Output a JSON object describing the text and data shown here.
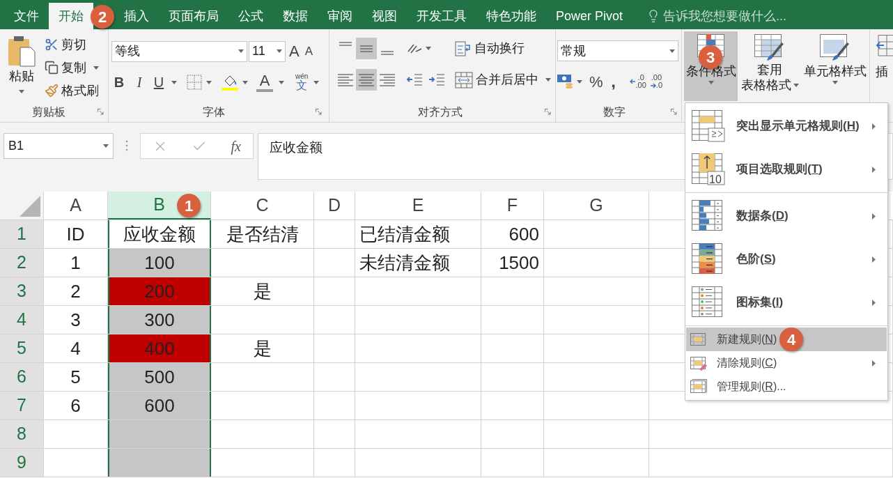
{
  "tabs": [
    {
      "label": "文件",
      "selected": false
    },
    {
      "label": "开始",
      "selected": true,
      "badge": "2"
    },
    {
      "label": "插入",
      "selected": false
    },
    {
      "label": "页面布局",
      "selected": false
    },
    {
      "label": "公式",
      "selected": false
    },
    {
      "label": "数据",
      "selected": false
    },
    {
      "label": "审阅",
      "selected": false
    },
    {
      "label": "视图",
      "selected": false
    },
    {
      "label": "开发工具",
      "selected": false
    },
    {
      "label": "特色功能",
      "selected": false
    },
    {
      "label": "Power Pivot",
      "selected": false
    }
  ],
  "tell_me": "告诉我您想要做什么...",
  "ribbon": {
    "clipboard": {
      "paste": "粘贴",
      "cut": "剪切",
      "copy": "复制",
      "format_painter": "格式刷",
      "title": "剪贴板"
    },
    "font": {
      "family": "等线",
      "size": "11",
      "grow": "A",
      "shrink": "A",
      "bold": "B",
      "italic": "I",
      "underline": "U",
      "font_color": "A",
      "phonetic_top": "wén",
      "phonetic": "文",
      "title": "字体"
    },
    "alignment": {
      "buttons": [
        {
          "kind": "top",
          "selected": false
        },
        {
          "kind": "middle",
          "selected": true
        },
        {
          "kind": "bottom",
          "selected": false
        },
        {
          "kind": "left",
          "selected": false
        },
        {
          "kind": "center",
          "selected": true
        },
        {
          "kind": "right",
          "selected": false
        }
      ],
      "wrap": "自动换行",
      "merge": "合并后居中",
      "title": "对齐方式"
    },
    "number": {
      "format": "常规",
      "percent": "%",
      "comma": ",",
      "increase_decimal": [
        ".0",
        ".00"
      ],
      "decrease_decimal": [
        ".00",
        ".0"
      ],
      "title": "数字"
    },
    "styles": {
      "conditional": {
        "label": "条件格式",
        "pressed": true,
        "badge": "3"
      },
      "table": [
        "套用",
        "表格格式"
      ],
      "cell_styles": "单元格样式"
    },
    "cells": {
      "insert": "插"
    }
  },
  "formula_bar": {
    "name_box": "B1",
    "fx": "fx",
    "value": "应收金额"
  },
  "sheet": {
    "columns": [
      {
        "label": "A",
        "selected": false
      },
      {
        "label": "B",
        "selected": true,
        "badge": "1"
      },
      {
        "label": "C",
        "selected": false
      },
      {
        "label": "D",
        "selected": false
      },
      {
        "label": "E",
        "selected": false
      },
      {
        "label": "F",
        "selected": false
      },
      {
        "label": "G",
        "selected": false
      }
    ],
    "rows": [
      {
        "number": "1",
        "cells": [
          {
            "text": "ID"
          },
          {
            "text": "应收金额",
            "active": true
          },
          {
            "text": "是否结清"
          },
          {},
          {
            "text": "已结清金额"
          },
          {
            "text": "600"
          },
          {}
        ]
      },
      {
        "number": "2",
        "cells": [
          {
            "text": "1"
          },
          {
            "text": "100"
          },
          {},
          {},
          {
            "text": "未结清金额"
          },
          {
            "text": "1500"
          },
          {}
        ]
      },
      {
        "number": "3",
        "cells": [
          {
            "text": "2"
          },
          {
            "text": "200",
            "color": "#c00000"
          },
          {
            "text": "是"
          },
          {},
          {},
          {},
          {}
        ]
      },
      {
        "number": "4",
        "cells": [
          {
            "text": "3"
          },
          {
            "text": "300"
          },
          {},
          {},
          {},
          {},
          {}
        ]
      },
      {
        "number": "5",
        "cells": [
          {
            "text": "4"
          },
          {
            "text": "400",
            "color": "#c00000"
          },
          {
            "text": "是"
          },
          {},
          {},
          {},
          {}
        ]
      },
      {
        "number": "6",
        "cells": [
          {
            "text": "5"
          },
          {
            "text": "500"
          },
          {},
          {},
          {},
          {},
          {}
        ]
      },
      {
        "number": "7",
        "cells": [
          {
            "text": "6"
          },
          {
            "text": "600"
          },
          {},
          {},
          {},
          {},
          {}
        ]
      },
      {
        "number": "8",
        "cells": [
          {},
          {},
          {},
          {},
          {},
          {},
          {}
        ]
      },
      {
        "number": "9",
        "cells": [
          {},
          {},
          {},
          {},
          {},
          {},
          {}
        ]
      }
    ]
  },
  "menu": {
    "sections": [
      [
        {
          "kind": "large",
          "before": "突出显示单元格规则(",
          "key": "H",
          "after": ")",
          "submenu": true,
          "selected": false
        },
        {
          "kind": "large",
          "before": "项目选取规则(",
          "key": "T",
          "after": ")",
          "submenu": true,
          "selected": false,
          "icon_text": "10"
        }
      ],
      [
        {
          "kind": "large",
          "before": "数据条(",
          "key": "D",
          "after": ")",
          "submenu": true,
          "selected": false
        },
        {
          "kind": "large",
          "before": "色阶(",
          "key": "S",
          "after": ")",
          "submenu": true,
          "selected": false
        },
        {
          "kind": "large",
          "before": "图标集(",
          "key": "I",
          "after": ")",
          "submenu": true,
          "selected": false
        }
      ],
      [
        {
          "kind": "small",
          "before": "新建规则(",
          "key": "N",
          "after": ")",
          "submenu": false,
          "selected": true,
          "badge": "4"
        },
        {
          "kind": "small",
          "before": "清除规则(",
          "key": "C",
          "after": ")",
          "submenu": true,
          "selected": false
        },
        {
          "kind": "small",
          "before": "管理规则(",
          "key": "R",
          "after": ")...",
          "submenu": false,
          "selected": false
        }
      ]
    ]
  }
}
